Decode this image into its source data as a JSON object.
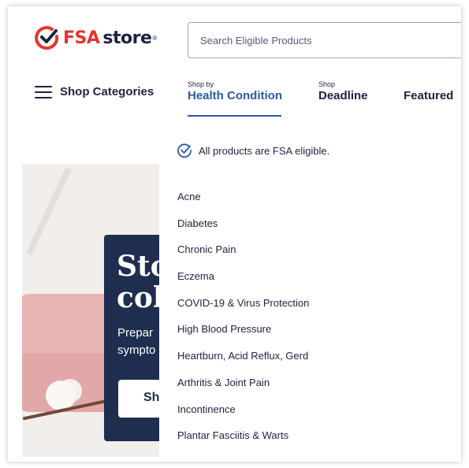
{
  "header": {
    "logo_fsa": "FSA",
    "logo_store": "store",
    "logo_reg": "®",
    "search_placeholder": "Search Eligible Products"
  },
  "nav": {
    "categories_label": "Shop Categories",
    "tabs": [
      {
        "small": "Shop by",
        "label": "Health Condition",
        "active": true
      },
      {
        "small": "Shop",
        "label": "Deadline"
      },
      {
        "small": "",
        "label": "Featured"
      }
    ]
  },
  "dropdown": {
    "eligibility_note": "All products are FSA eligible.",
    "conditions": [
      "Acne",
      "Diabetes",
      "Chronic Pain",
      "Eczema",
      "COVID-19 & Virus Protection",
      "High Blood Pressure",
      "Heartburn, Acid Reflux, Gerd",
      "Arthritis & Joint Pain",
      "Incontinence",
      "Plantar Fasciitis & Warts"
    ]
  },
  "hero": {
    "headline_line1": "Sto",
    "headline_line2": "col",
    "sub_line1": "Prepar",
    "sub_line2": "sympto",
    "button_label": "Sh"
  },
  "colors": {
    "brand_red": "#e8322e",
    "navy": "#1c2340",
    "accent_blue": "#2a58a8",
    "promo_bg": "#1f2d4e"
  }
}
